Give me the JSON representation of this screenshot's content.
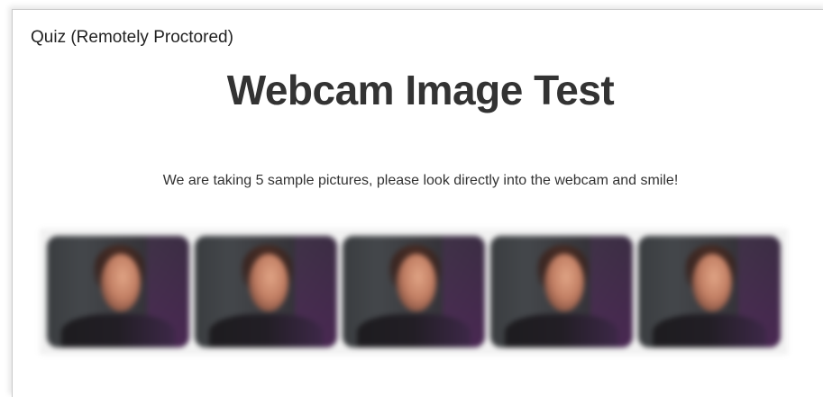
{
  "page": {
    "quiz_title": "Quiz (Remotely Proctored)",
    "heading": "Webcam Image Test",
    "instructions": "We are taking 5 sample pictures, please look directly into the webcam and smile!"
  },
  "samples": {
    "count": 5,
    "images": [
      "webcam-sample-1",
      "webcam-sample-2",
      "webcam-sample-3",
      "webcam-sample-4",
      "webcam-sample-5"
    ]
  },
  "colors": {
    "heading": "#333333",
    "text": "#222222"
  }
}
